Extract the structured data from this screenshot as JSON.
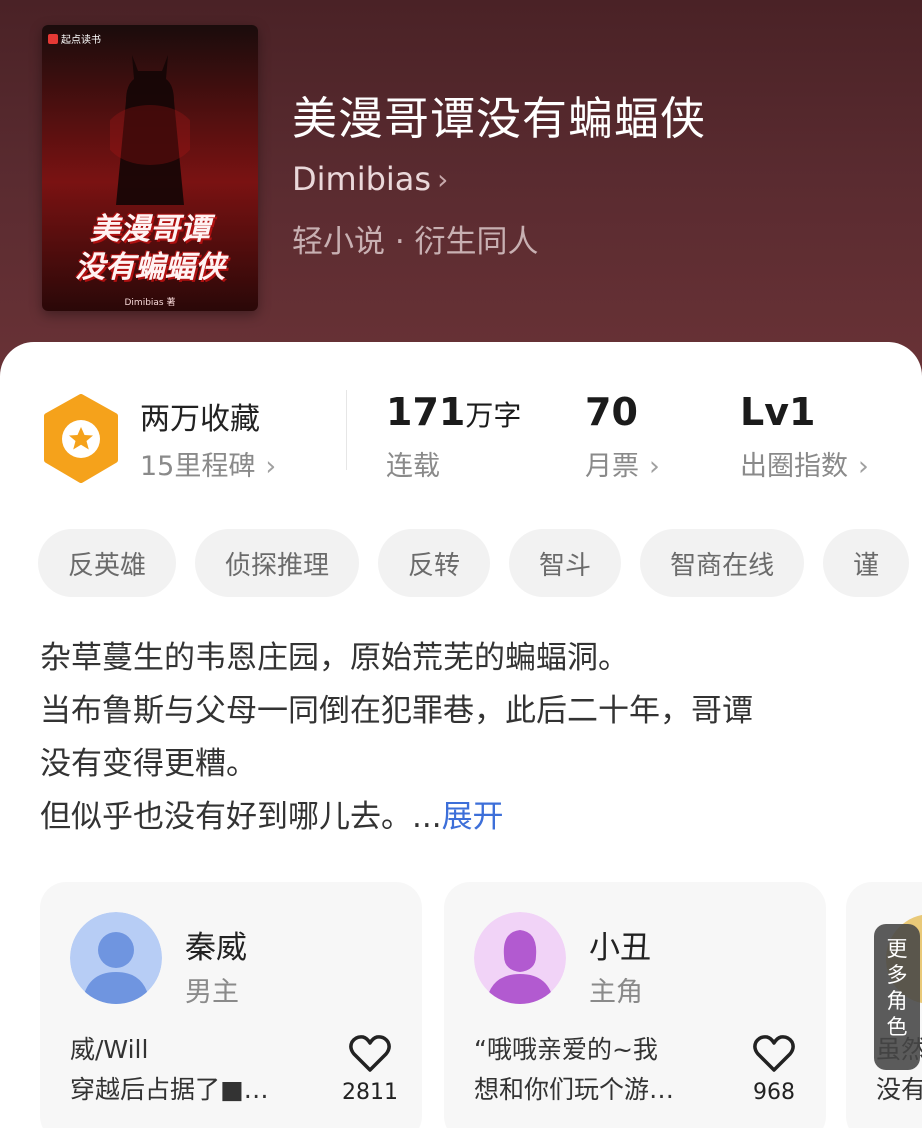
{
  "book": {
    "title": "美漫哥谭没有蝙蝠侠",
    "author": "Dimibias",
    "genre": "轻小说 · 衍生同人",
    "cover": {
      "brand": "起点读书",
      "title_line1": "美漫哥谭",
      "title_line2": "没有蝙蝠侠",
      "author": "Dimibias 著"
    }
  },
  "stats": {
    "favorites_title": "两万收藏",
    "milestones": "15里程碑",
    "word_count_value": "171",
    "word_count_unit": "万字",
    "status": "连载",
    "monthly_tickets_value": "70",
    "monthly_tickets_label": "月票",
    "level_value": "Lv1",
    "level_label": "出圈指数"
  },
  "tags": [
    "反英雄",
    "侦探推理",
    "反转",
    "智斗",
    "智商在线",
    "谨"
  ],
  "description": {
    "line1": "杂草蔓生的韦恩庄园，原始荒芜的蝙蝠洞。",
    "line2": "当布鲁斯与父母一同倒在犯罪巷，此后二十年，哥谭",
    "line3": "没有变得更糟。",
    "line4": "但似乎也没有好到哪儿去。...",
    "expand": "展开"
  },
  "characters": [
    {
      "name": "秦威",
      "role": "男主",
      "quote_line1": "威/Will",
      "quote_line2": "穿越后占据了■…",
      "likes": "2811"
    },
    {
      "name": "小丑",
      "role": "主角",
      "quote_line1": "“哦哦亲爱的~我",
      "quote_line2": "想和你们玩个游…",
      "likes": "968"
    }
  ],
  "more_characters": {
    "label": "更多角色",
    "peek_line1": "虽然",
    "peek_line2": "没有"
  },
  "colors": {
    "header_bg": "#5a2b30",
    "badge_orange": "#f5a21b",
    "link_blue": "#3d6fd9",
    "tag_bg": "#f2f2f2"
  }
}
